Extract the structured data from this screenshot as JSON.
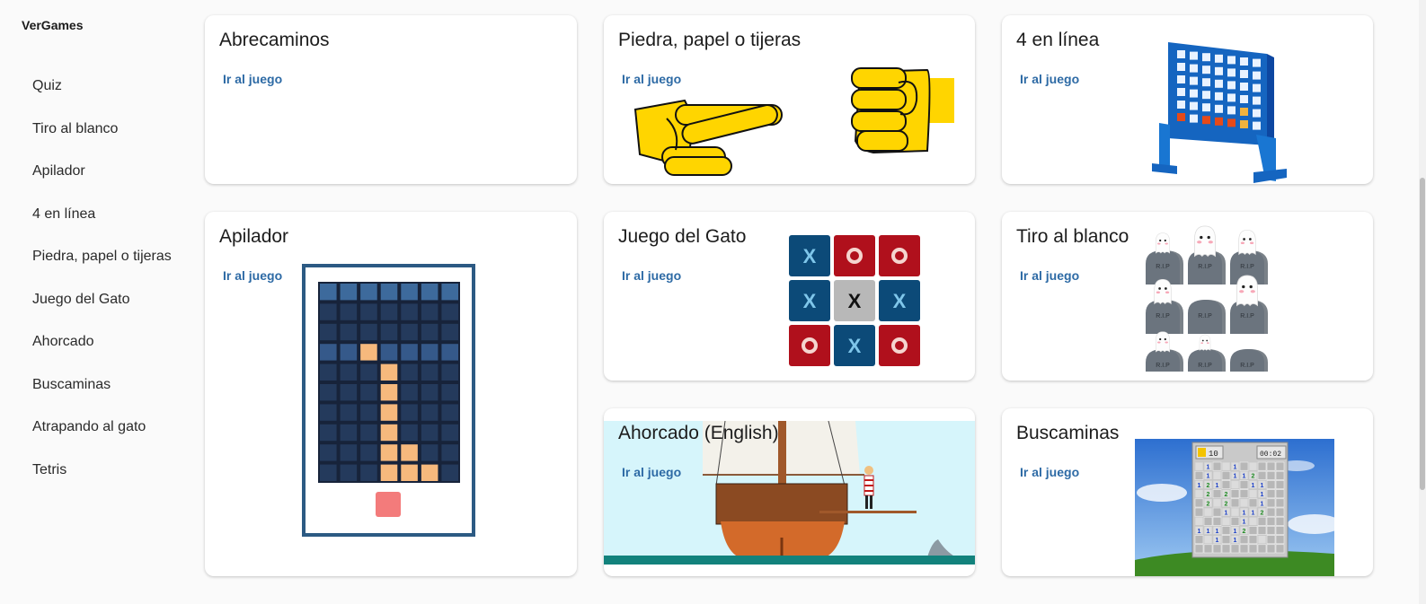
{
  "app": {
    "brand": "VerGames"
  },
  "sidebar": {
    "items": [
      {
        "label": "Quiz"
      },
      {
        "label": "Tiro al blanco"
      },
      {
        "label": "Apilador"
      },
      {
        "label": "4 en línea"
      },
      {
        "label": "Piedra, papel o tijeras"
      },
      {
        "label": "Juego del Gato"
      },
      {
        "label": "Ahorcado"
      },
      {
        "label": "Buscaminas"
      },
      {
        "label": "Atrapando al gato"
      },
      {
        "label": "Tetris"
      }
    ]
  },
  "cards": {
    "abrecaminos": {
      "title": "Abrecaminos",
      "link": "Ir al juego"
    },
    "piedra": {
      "title": "Piedra, papel o tijeras",
      "link": "Ir al juego"
    },
    "cuatro": {
      "title": "4 en línea",
      "link": "Ir al juego"
    },
    "apilador": {
      "title": "Apilador",
      "link": "Ir al juego"
    },
    "gato": {
      "title": "Juego del Gato",
      "link": "Ir al juego",
      "board": [
        "X",
        "O",
        "O",
        "X",
        "X",
        "X",
        "O",
        "X",
        "O"
      ]
    },
    "tiro": {
      "title": "Tiro al blanco",
      "link": "Ir al juego",
      "tomb_text": "R.I.P"
    },
    "ahorcado": {
      "title": "Ahorcado (English)",
      "link": "Ir al juego"
    },
    "buscaminas": {
      "title": "Buscaminas",
      "link": "Ir al juego",
      "mines": "10",
      "timer": "00:02"
    }
  },
  "colors": {
    "link": "#2d6aa5",
    "card_bg": "#ffffff",
    "page_bg": "#fafafa",
    "gato_blue": "#0c4a78",
    "gato_red": "#b0101c",
    "stacker_frame": "#2c5a83"
  }
}
